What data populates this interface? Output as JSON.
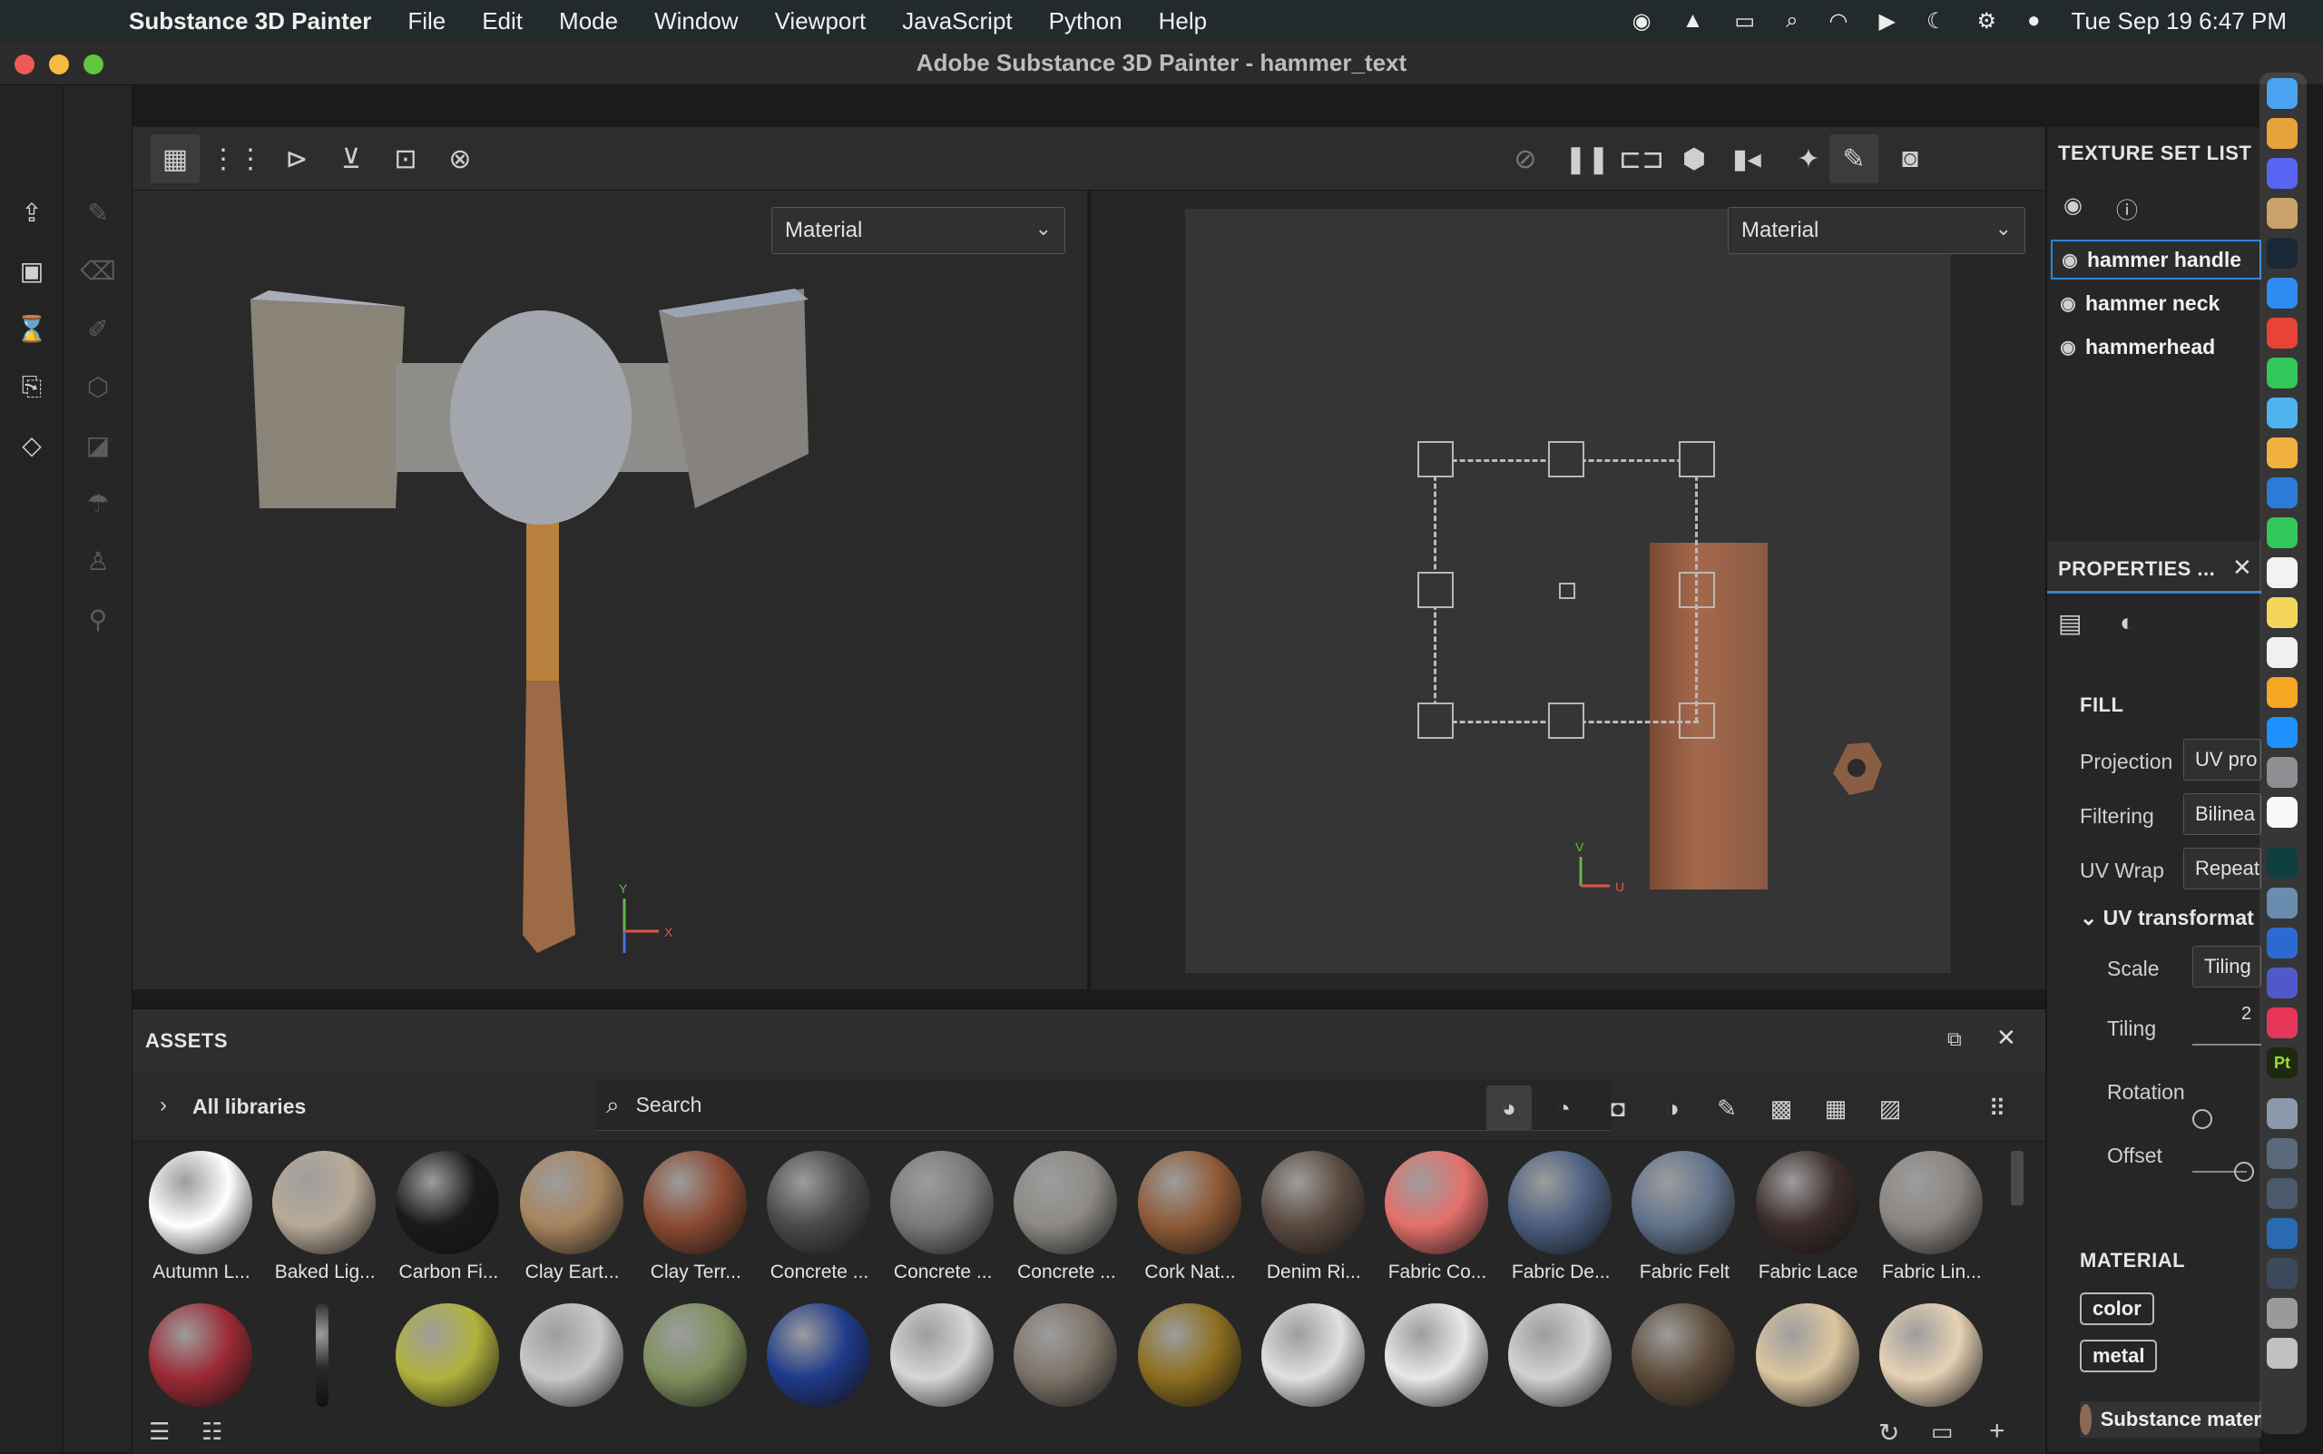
{
  "menubar": {
    "app_name": "Substance 3D Painter",
    "items": [
      "File",
      "Edit",
      "Mode",
      "Window",
      "Viewport",
      "JavaScript",
      "Python",
      "Help"
    ],
    "datetime": "Tue Sep 19  6:47 PM"
  },
  "window": {
    "title": "Adobe Substance 3D Painter - hammer_text"
  },
  "viewport_left": {
    "mode": "Material",
    "axis_y": "Y",
    "axis_x": "X"
  },
  "viewport_right": {
    "mode": "Material",
    "axis_v": "V",
    "axis_u": "U"
  },
  "texture_set_list": {
    "title": "TEXTURE SET LIST",
    "items": [
      {
        "label": "hammer handle",
        "selected": true
      },
      {
        "label": "hammer neck",
        "selected": false
      },
      {
        "label": "hammerhead",
        "selected": false
      }
    ]
  },
  "properties": {
    "title": "PROPERTIES ...",
    "section_fill": "FILL",
    "projection_label": "Projection",
    "projection_value": "UV pro",
    "filtering_label": "Filtering",
    "filtering_value": "Bilinea",
    "uvwrap_label": "UV Wrap",
    "uvwrap_value": "Repeat",
    "uv_transform_label": "UV transformat",
    "scale_label": "Scale",
    "scale_value": "Tiling",
    "tiling_label": "Tiling",
    "tiling_value": "2",
    "rotation_label": "Rotation",
    "offset_label": "Offset",
    "section_material": "MATERIAL",
    "chip_color": "color",
    "chip_metal": "metal",
    "material_name": "Substance mater"
  },
  "assets": {
    "title": "ASSETS",
    "library": "All libraries",
    "search_placeholder": "Search",
    "row1": [
      {
        "name": "Autumn L...",
        "color": "#ffffff"
      },
      {
        "name": "Baked Lig...",
        "color": "#b8aa98"
      },
      {
        "name": "Carbon Fi...",
        "color": "#1a1a1a"
      },
      {
        "name": "Clay Eart...",
        "color": "#a7845f"
      },
      {
        "name": "Clay Terr...",
        "color": "#8a4a32"
      },
      {
        "name": "Concrete ...",
        "color": "#4a4a4d"
      },
      {
        "name": "Concrete ...",
        "color": "#7a7a7a"
      },
      {
        "name": "Concrete ...",
        "color": "#8d8a85"
      },
      {
        "name": "Cork Nat...",
        "color": "#8e5a36"
      },
      {
        "name": "Denim Ri...",
        "color": "#5a4a40"
      },
      {
        "name": "Fabric Co...",
        "color": "#e4706b"
      },
      {
        "name": "Fabric De...",
        "color": "#4b5f80"
      },
      {
        "name": "Fabric Felt",
        "color": "#62738c"
      },
      {
        "name": "Fabric Lace",
        "color": "#3b2d2b"
      },
      {
        "name": "Fabric Lin...",
        "color": "#8b8581"
      }
    ],
    "row2_colors": [
      "#9c2a35",
      "#2a2a2a",
      "#b2b23e",
      "#c8c8c8",
      "#7f8f5d",
      "#1f3a8a",
      "#d6d6d6",
      "#7d7468",
      "#8c6e1e",
      "#e0e0e0",
      "#e8e8e8",
      "#d2d2d2",
      "#5e4c3a",
      "#dcc6a0",
      "#e6d2b4"
    ]
  }
}
